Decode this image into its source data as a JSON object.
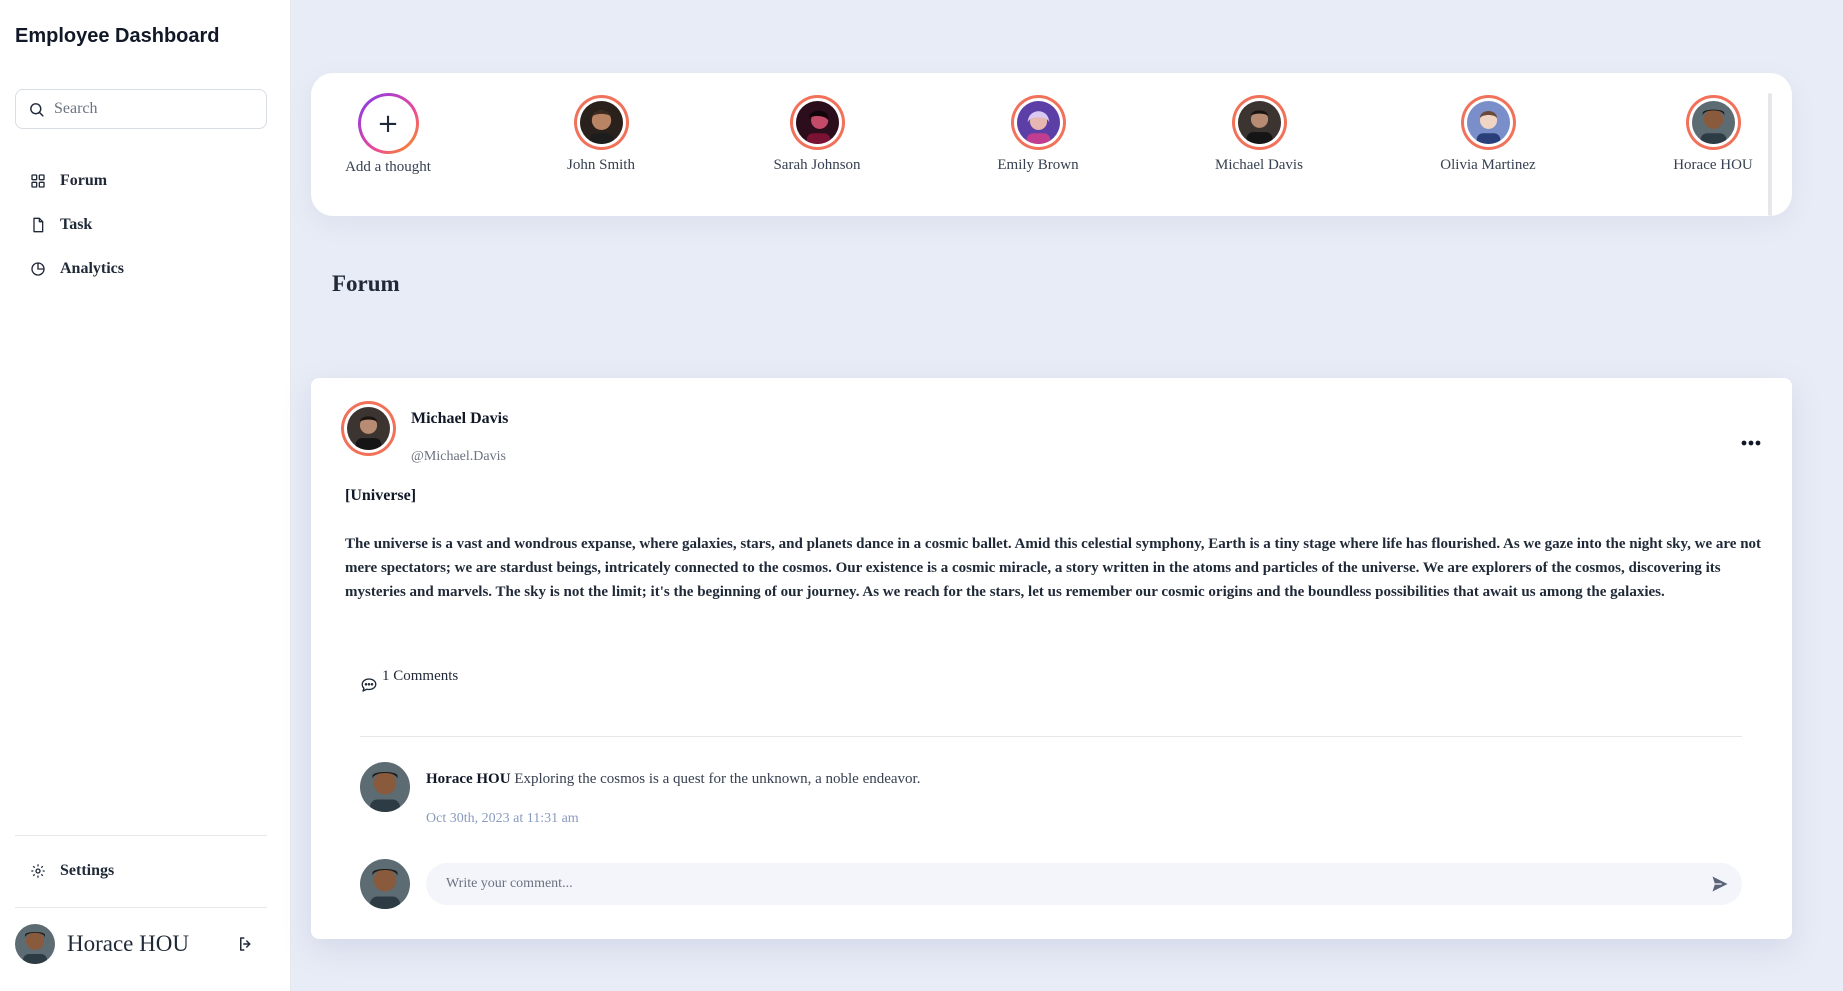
{
  "app": {
    "title": "Employee Dashboard"
  },
  "search": {
    "placeholder": "Search"
  },
  "sidebar": {
    "items": [
      {
        "label": "Forum",
        "icon": "grid-icon"
      },
      {
        "label": "Task",
        "icon": "document-icon"
      },
      {
        "label": "Analytics",
        "icon": "pie-chart-icon"
      }
    ],
    "settings_label": "Settings",
    "user_name": "Horace HOU"
  },
  "stories": {
    "add_label": "Add a thought",
    "people": [
      {
        "name": "John Smith"
      },
      {
        "name": "Sarah Johnson"
      },
      {
        "name": "Emily Brown"
      },
      {
        "name": "Michael Davis"
      },
      {
        "name": "Olivia Martinez"
      },
      {
        "name": "Horace HOU"
      }
    ]
  },
  "section": {
    "title": "Forum"
  },
  "post": {
    "author": "Michael Davis",
    "handle": "@Michael.Davis",
    "topic": "[Universe]",
    "body": "The universe is a vast and wondrous expanse, where galaxies, stars, and planets dance in a cosmic ballet. Amid this celestial symphony, Earth is a tiny stage where life has flourished. As we gaze into the night sky, we are not mere spectators; we are stardust beings, intricately connected to the cosmos. Our existence is a cosmic miracle, a story written in the atoms and particles of the universe. We are explorers of the cosmos, discovering its mysteries and marvels. The sky is not the limit; it's the beginning of our journey. As we reach for the stars, let us remember our cosmic origins and the boundless possibilities that await us among the galaxies.",
    "comment_count": "1 Comments",
    "comments": [
      {
        "author": "Horace HOU",
        "text": "Exploring the cosmos is a quest for the unknown, a noble endeavor.",
        "date": "Oct 30th, 2023 at 11:31 am"
      }
    ],
    "reply_placeholder": "Write your comment..."
  },
  "colors": {
    "background": "#e8ecf6",
    "story_ring": "#f1715a",
    "date_text": "#8a9bbf"
  }
}
